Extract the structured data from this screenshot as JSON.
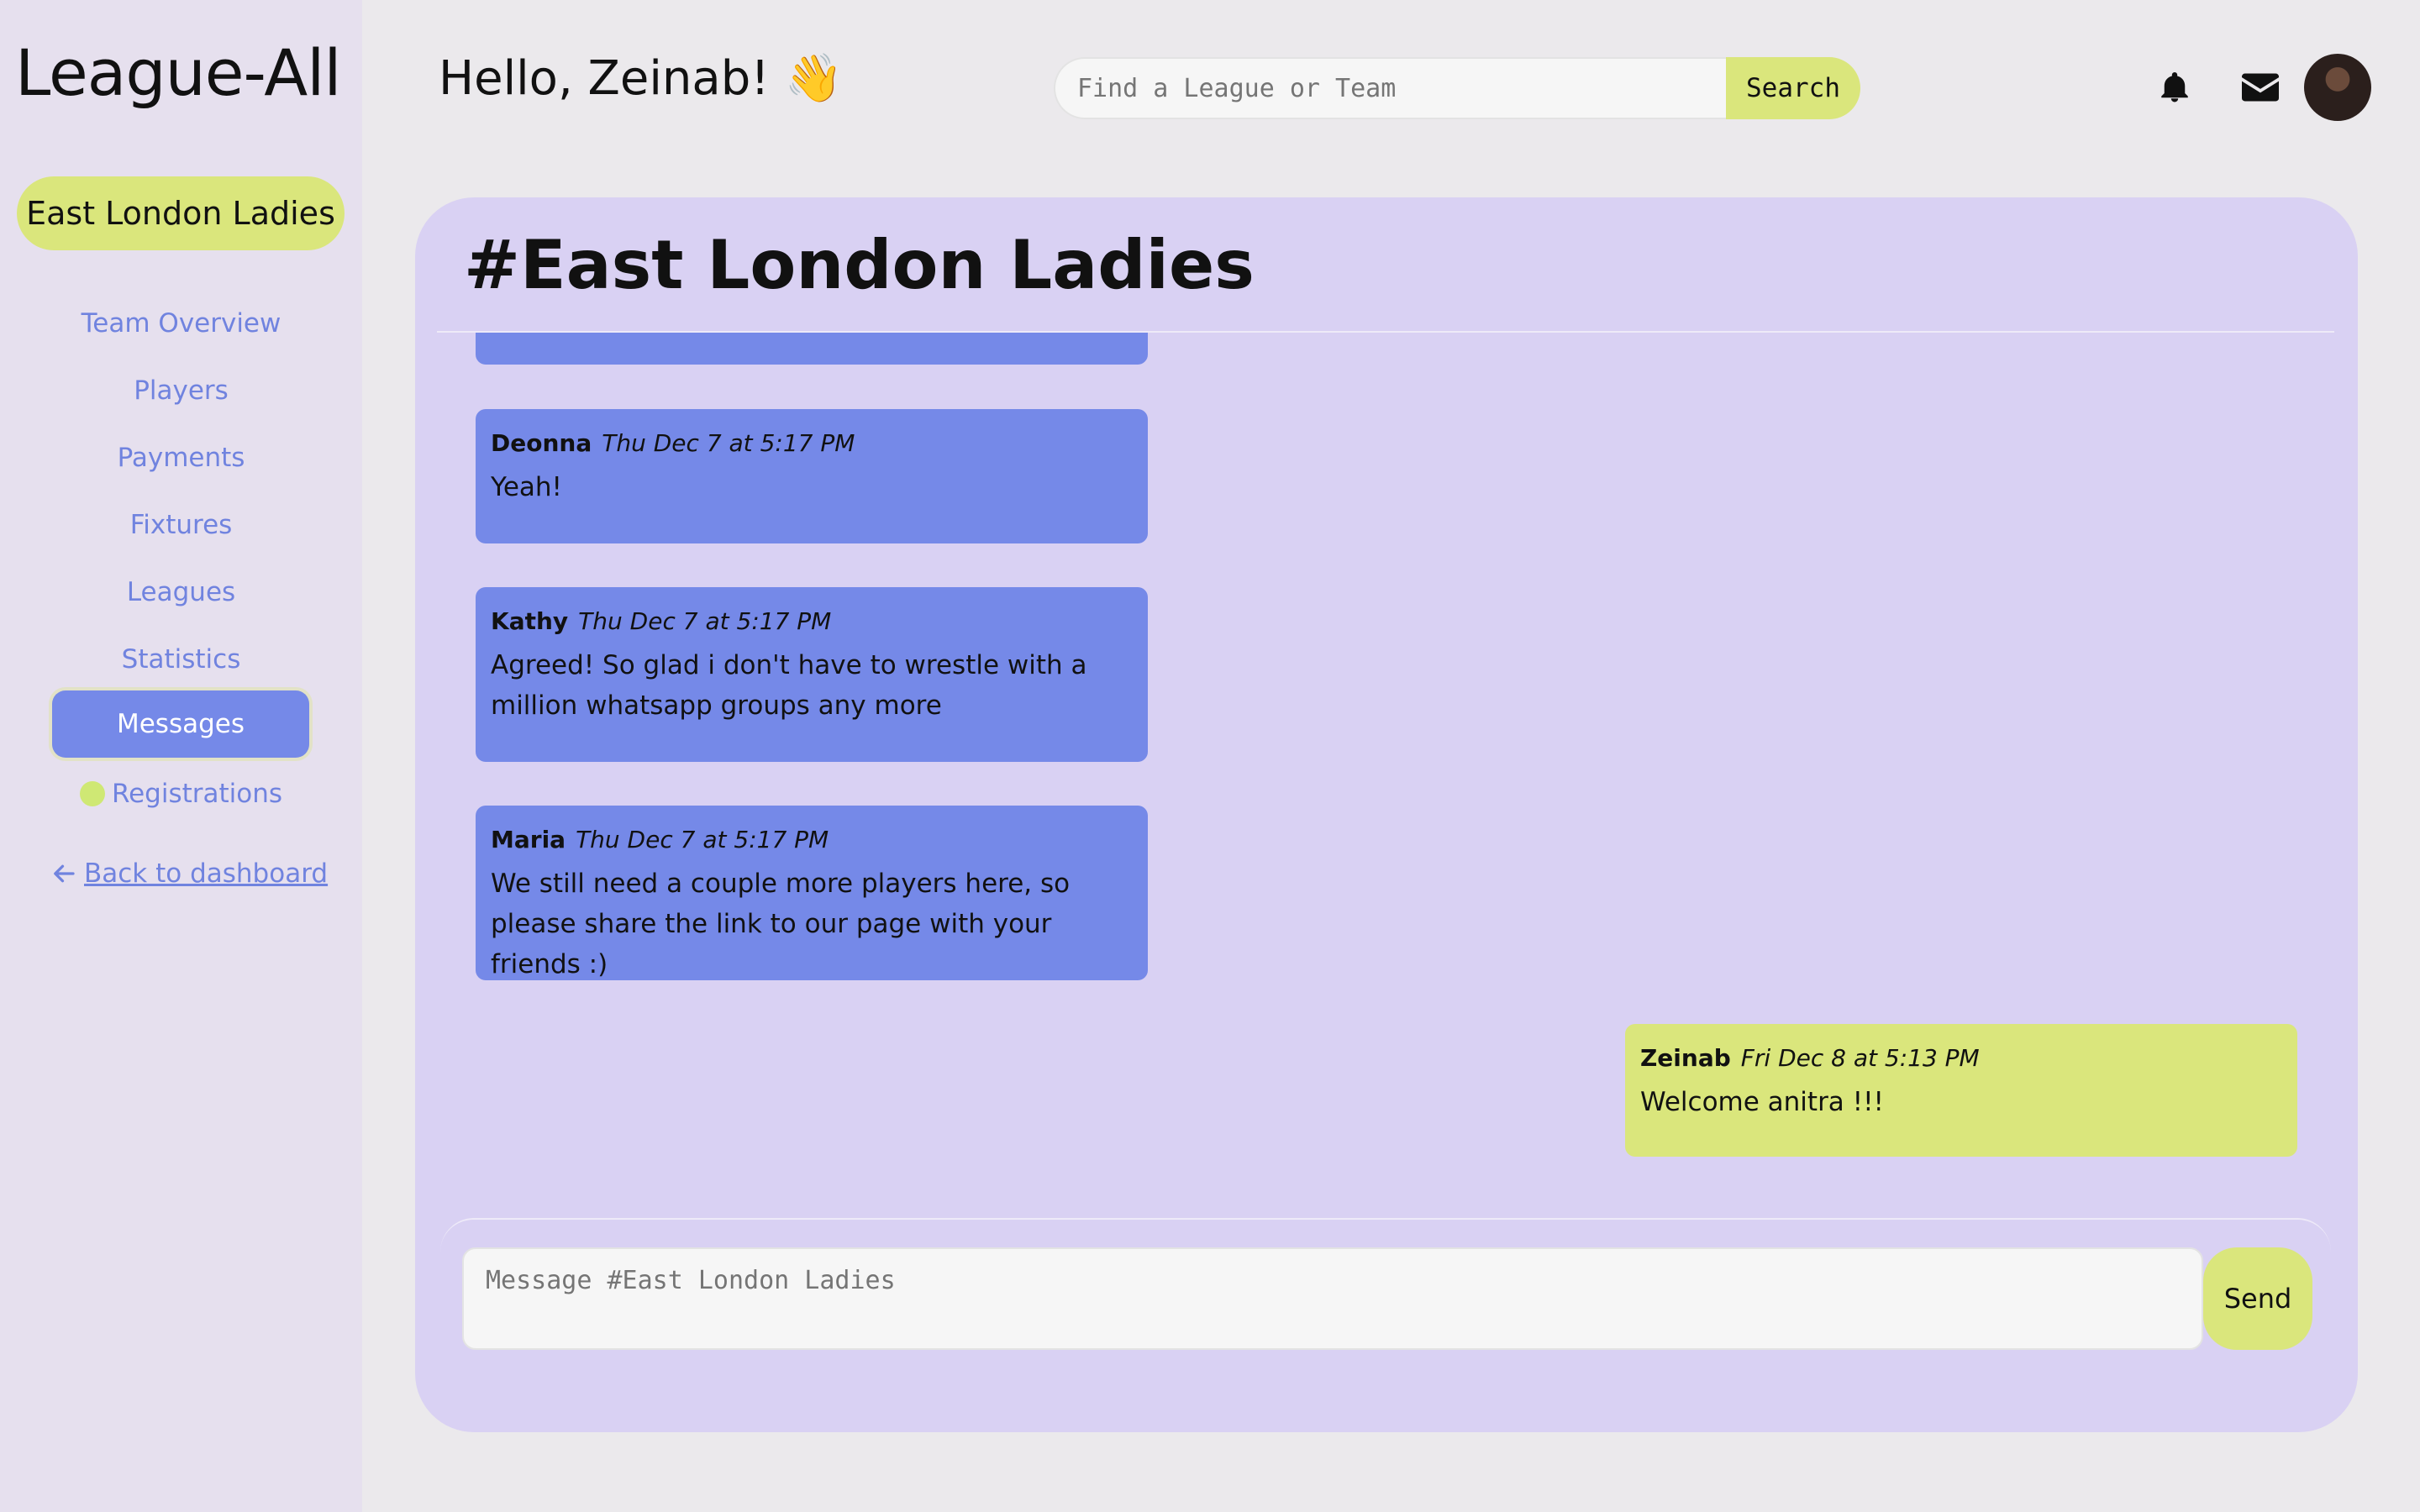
{
  "app": {
    "brand": "League-All"
  },
  "header": {
    "greeting": "Hello, Zeinab! 👋",
    "search_placeholder": "Find a League or Team",
    "search_label": "Search"
  },
  "sidebar": {
    "team_name": "East London Ladies",
    "items": [
      {
        "label": "Team Overview"
      },
      {
        "label": "Players"
      },
      {
        "label": "Payments"
      },
      {
        "label": "Fixtures"
      },
      {
        "label": "Leagues"
      },
      {
        "label": "Statistics"
      },
      {
        "label": "Messages",
        "active": true
      },
      {
        "label": "Registrations"
      }
    ],
    "back_link": "Back to dashboard"
  },
  "chat": {
    "title": "#East London Ladies",
    "messages": [
      {
        "author": "Deonna",
        "time": "Thu Dec 7 at 5:17 PM",
        "text": "Yeah!"
      },
      {
        "author": "Kathy",
        "time": "Thu Dec 7 at 5:17 PM",
        "text": "Agreed! So glad i don't have to wrestle with a million whatsapp groups any more"
      },
      {
        "author": "Maria",
        "time": "Thu Dec 7 at 5:17 PM",
        "text": "We still need a couple more players here, so please share the link to our page with your friends :)"
      },
      {
        "author": "Zeinab",
        "time": "Fri Dec 8 at 5:13 PM",
        "text": "Welcome anitra !!!"
      }
    ],
    "compose_placeholder": "Message #East London Ladies",
    "send_label": "Send"
  },
  "colors": {
    "accent_lime": "#dae67c",
    "accent_blue": "#7589e8",
    "panel": "#d9d1f3",
    "sidebar": "#e6e0ee"
  },
  "icons": [
    "bell-icon",
    "mail-icon",
    "arrow-left-icon"
  ]
}
